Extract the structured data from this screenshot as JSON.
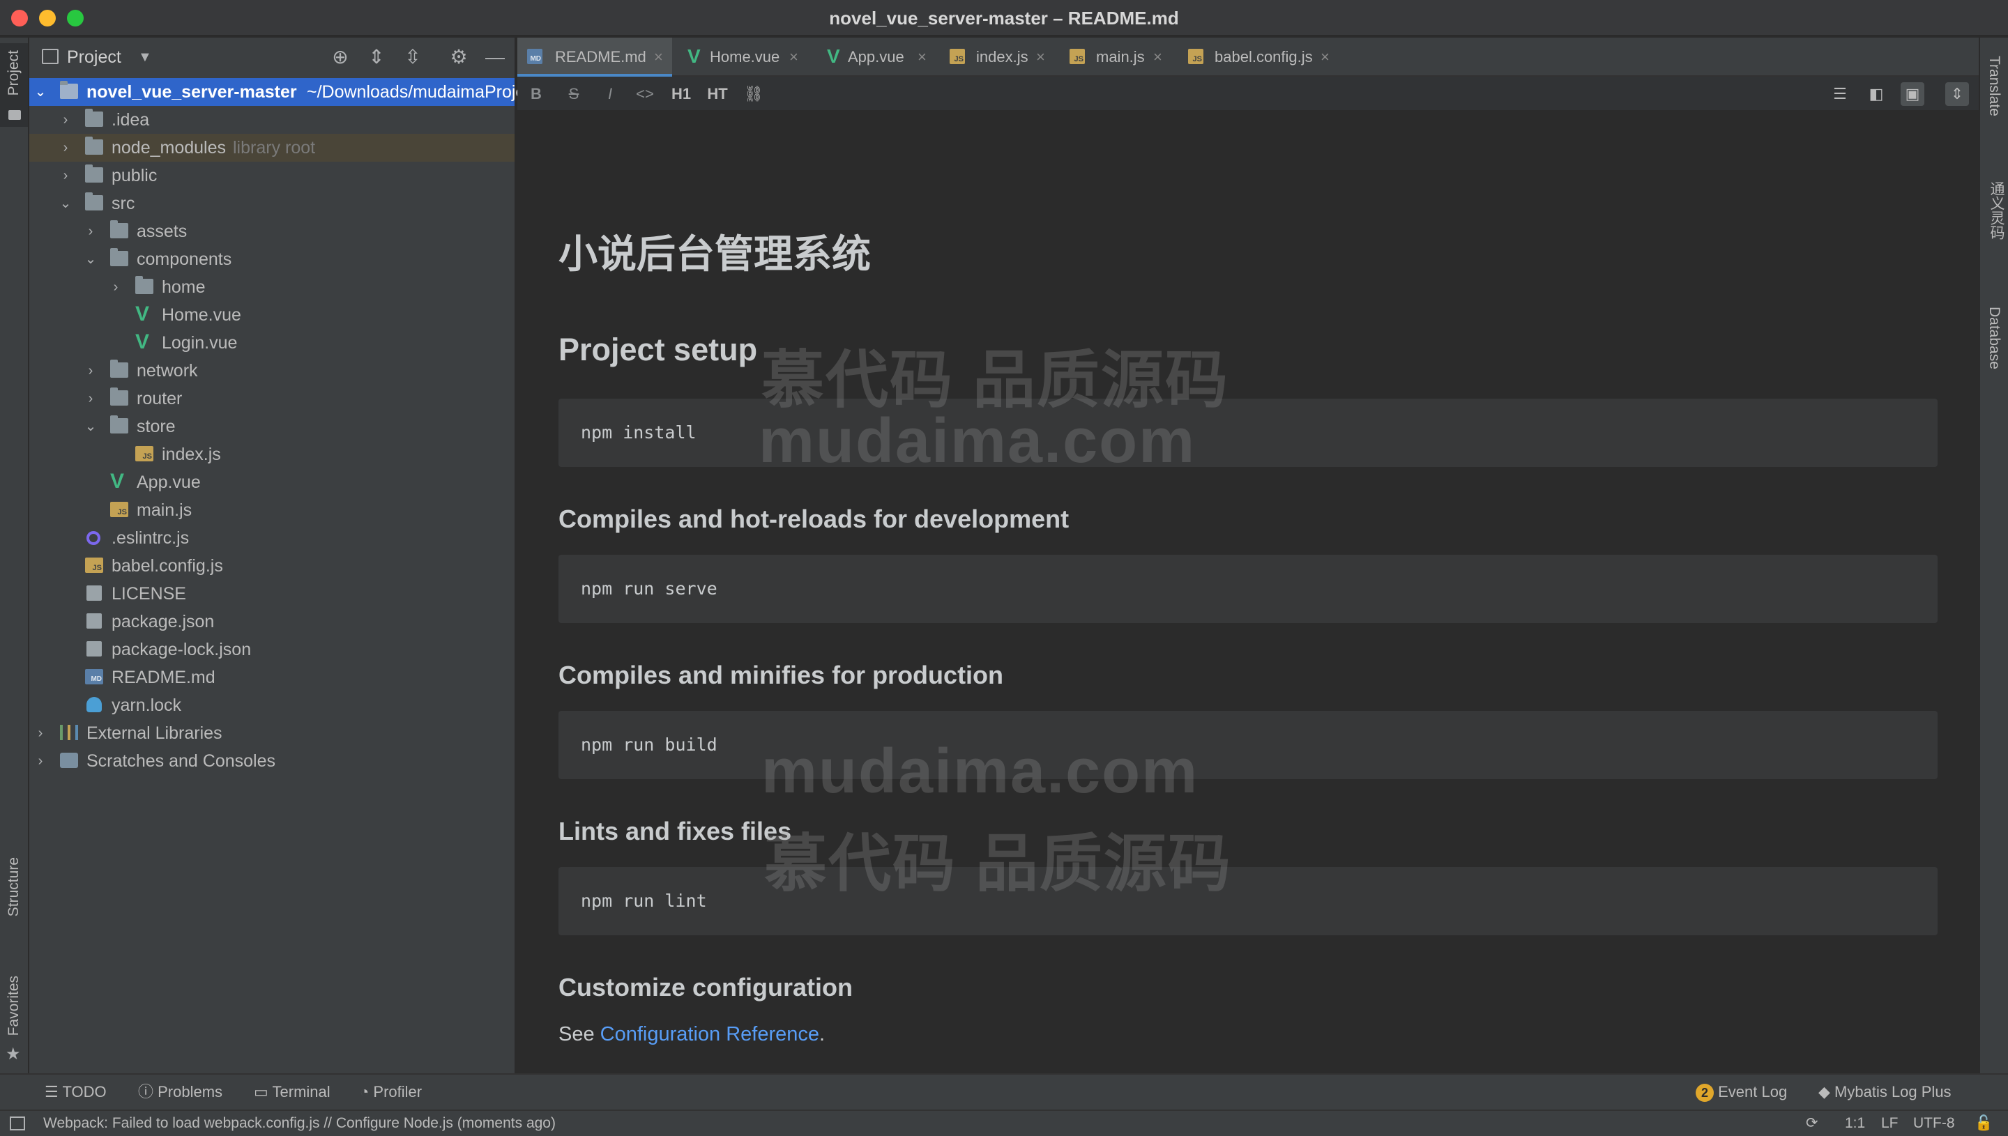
{
  "window": {
    "title": "novel_vue_server-master – README.md"
  },
  "left_strip": {
    "project": "Project",
    "structure": "Structure",
    "favorites": "Favorites"
  },
  "right_strip": {
    "translate": "Translate",
    "tongyi": "通义灵码",
    "database": "Database"
  },
  "project_panel": {
    "title": "Project",
    "tree": {
      "root_name": "novel_vue_server-master",
      "root_path": "~/Downloads/mudaimaProject",
      "items": [
        ".idea",
        "node_modules",
        "public",
        "src",
        "assets",
        "components",
        "home",
        "Home.vue",
        "Login.vue",
        "network",
        "router",
        "store",
        "index.js",
        "App.vue",
        "main.js",
        ".eslintrc.js",
        "babel.config.js",
        "LICENSE",
        "package.json",
        "package-lock.json",
        "README.md",
        "yarn.lock",
        "External Libraries",
        "Scratches and Consoles"
      ],
      "node_modules_hint": "library root"
    }
  },
  "tabs": [
    "README.md",
    "Home.vue",
    "App.vue",
    "index.js",
    "main.js",
    "babel.config.js"
  ],
  "markdown_toolbar": {
    "h1": "H1",
    "ht": "HT"
  },
  "content": {
    "h1": "小说后台管理系统",
    "h2": "Project setup",
    "code1": "npm install",
    "h3a": "Compiles and hot-reloads for development",
    "code2": "npm run serve",
    "h3b": "Compiles and minifies for production",
    "code3": "npm run build",
    "h3c": "Lints and fixes files",
    "code4": "npm run lint",
    "h3d": "Customize configuration",
    "see": "See",
    "link": "Configuration Reference",
    "period": "."
  },
  "watermarks": {
    "cn1": "慕代码 品质源码",
    "en1": "mudaima.com",
    "en2": "mudaima.com",
    "cn2": "慕代码 品质源码"
  },
  "bottom_bar": {
    "todo": "TODO",
    "problems": "Problems",
    "terminal": "Terminal",
    "profiler": "Profiler",
    "event_log_count": "2",
    "event_log": "Event Log",
    "mybatis": "Mybatis Log Plus"
  },
  "status_bar": {
    "message": "Webpack: Failed to load webpack.config.js // Configure Node.js (moments ago)",
    "position": "1:1",
    "line_sep": "LF",
    "encoding": "UTF-8"
  },
  "colors": {
    "accent_selection": "#2f65ca",
    "vue_green": "#42b883",
    "link": "#589df6"
  }
}
